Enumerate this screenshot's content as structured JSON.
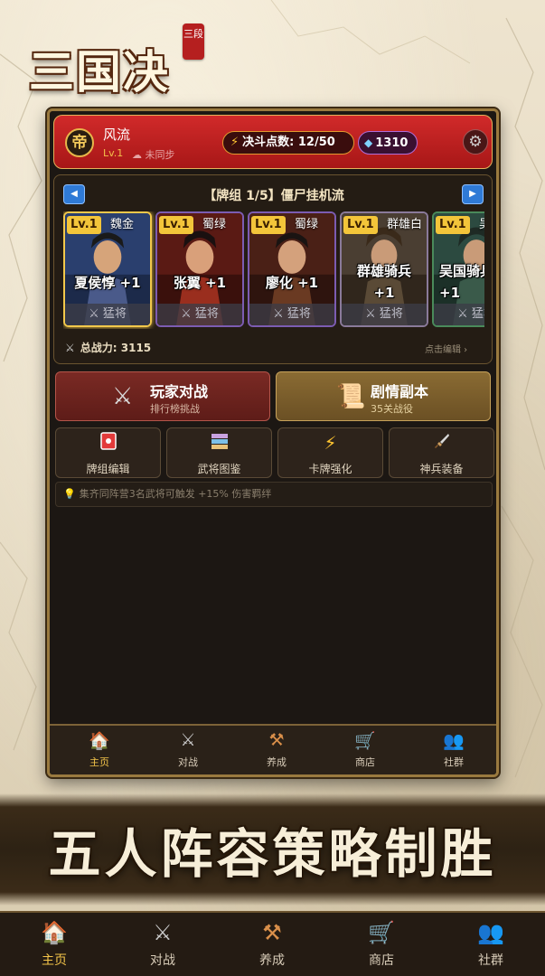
{
  "logo": {
    "title": "三国决",
    "seal": "三段"
  },
  "header": {
    "avatar_char": "帝",
    "player_name": "风流",
    "level": "Lv.1",
    "sync_status": "☁ 未同步",
    "duel_points": "决斗点数: 12/50",
    "gems": "1310",
    "icons": {
      "points": "lightning-bolt",
      "gems": "diamond",
      "settings": "gear"
    }
  },
  "deck": {
    "title": "【牌组 1/5】僵尸挂机流",
    "cards": [
      {
        "level": "Lv.1",
        "faction": "魏金",
        "name": "夏侯惇 +1",
        "type": "猛将",
        "selected": true,
        "color": "#3a5a9a"
      },
      {
        "level": "Lv.1",
        "faction": "蜀绿",
        "name": "张翼 +1",
        "type": "猛将",
        "selected": false,
        "color": "#8a2a1c"
      },
      {
        "level": "Lv.1",
        "faction": "蜀绿",
        "name": "廖化 +1",
        "type": "猛将",
        "selected": false,
        "color": "#7a3a22"
      },
      {
        "level": "Lv.1",
        "faction": "群雄白",
        "name": "群雄骑兵 +1",
        "type": "猛将",
        "selected": false,
        "color": "#5a4a3a"
      },
      {
        "level": "Lv.1",
        "faction": "吴",
        "name": "吴国骑兵 +1",
        "type": "猛将",
        "selected": false,
        "color": "#3a5a4a"
      }
    ],
    "total_power": "总战力: 3115",
    "edit_hint": "点击编辑 ›"
  },
  "actions": {
    "pvp": {
      "title": "玩家对战",
      "subtitle": "排行榜挑战"
    },
    "story": {
      "title": "剧情副本",
      "subtitle": "35关战役"
    }
  },
  "tools": [
    {
      "label": "牌组编辑",
      "icon": "red-card",
      "glyph": "▪",
      "color": "#e23a3a"
    },
    {
      "label": "武将图鉴",
      "icon": "books",
      "glyph": "☰",
      "color": "#c9a2e0"
    },
    {
      "label": "卡牌强化",
      "icon": "lightning",
      "glyph": "⚡",
      "color": "#ffc531"
    },
    {
      "label": "神兵装备",
      "icon": "dagger",
      "glyph": "🗡",
      "color": "#d0b080"
    }
  ],
  "tip": "集齐同阵营3名武将可触发 +15% 伤害羁绊",
  "nav": [
    {
      "label": "主页",
      "icon": "home",
      "active": true
    },
    {
      "label": "对战",
      "icon": "crossed-swords",
      "active": false
    },
    {
      "label": "养成",
      "icon": "hammers",
      "active": false
    },
    {
      "label": "商店",
      "icon": "cart",
      "active": false
    },
    {
      "label": "社群",
      "icon": "people",
      "active": false
    }
  ],
  "banner": "五人阵容策略制胜"
}
